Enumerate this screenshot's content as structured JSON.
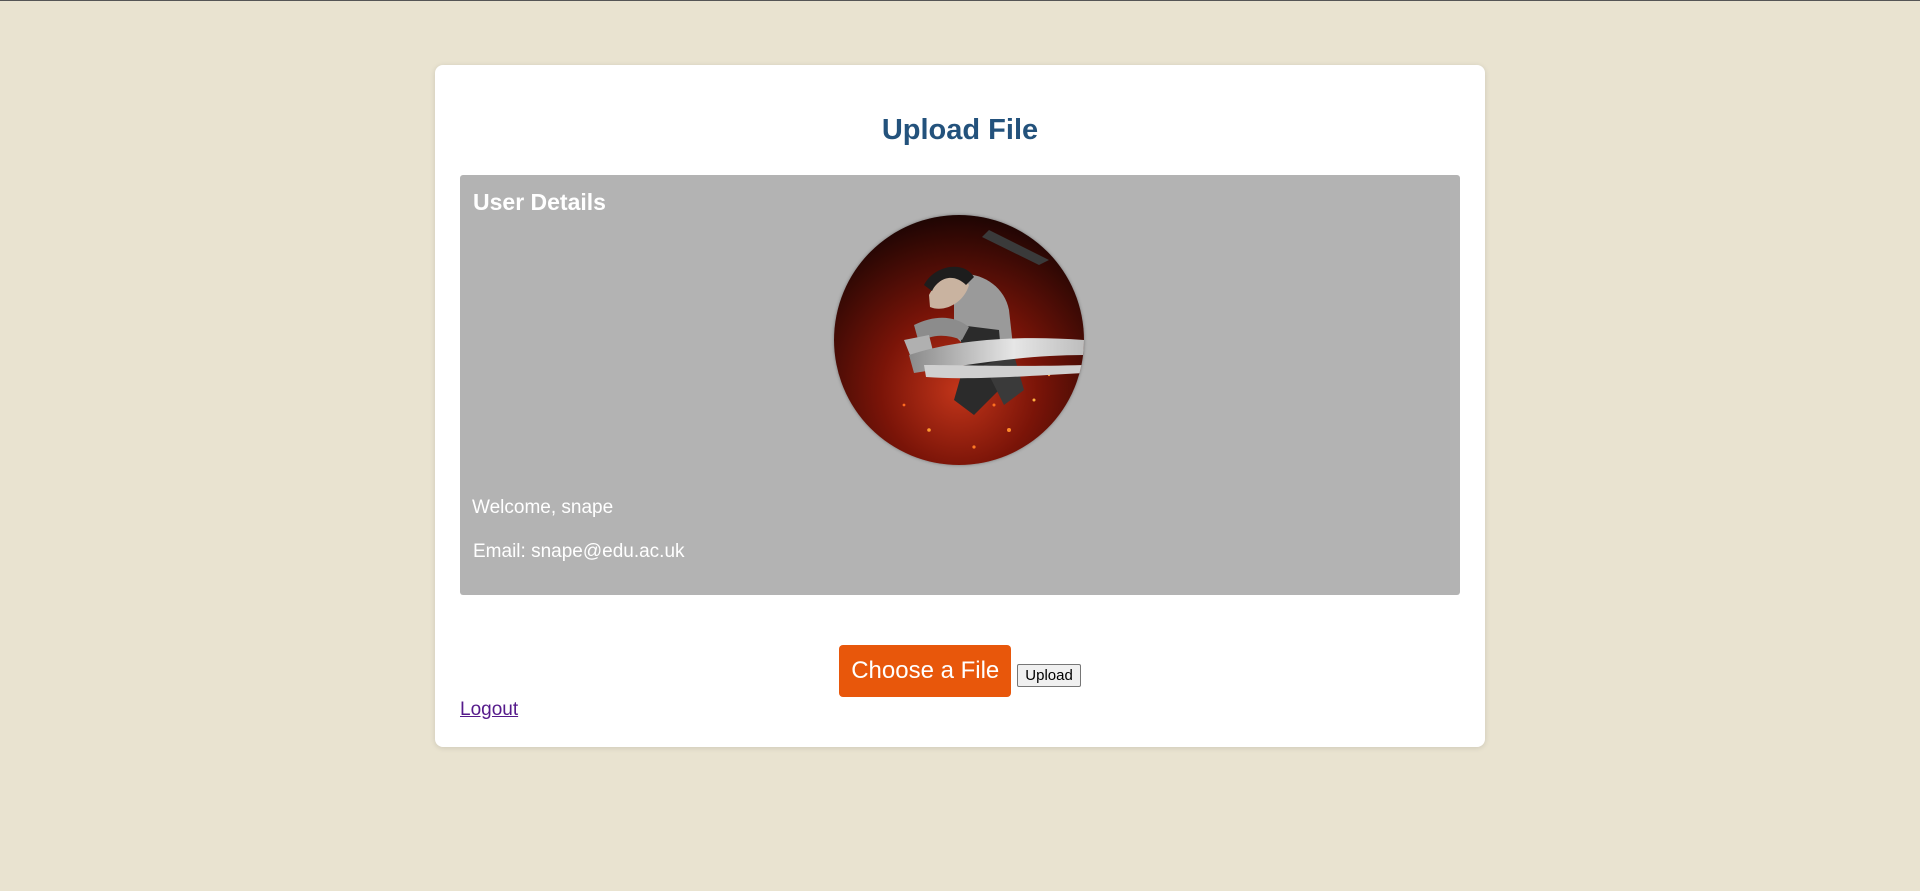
{
  "page": {
    "title": "Upload File"
  },
  "user_details": {
    "heading": "User Details",
    "avatar_icon": "profile-picture",
    "welcome": "Welcome, snape",
    "email": "Email: snape@edu.ac.uk"
  },
  "upload": {
    "choose_label": "Choose a File",
    "upload_label": "Upload"
  },
  "links": {
    "logout": "Logout"
  },
  "colors": {
    "background": "#e9e3d0",
    "title": "#23527c",
    "details_panel": "#b3b3b3",
    "choose_button": "#e8570b",
    "logout_link": "#551a8b"
  }
}
